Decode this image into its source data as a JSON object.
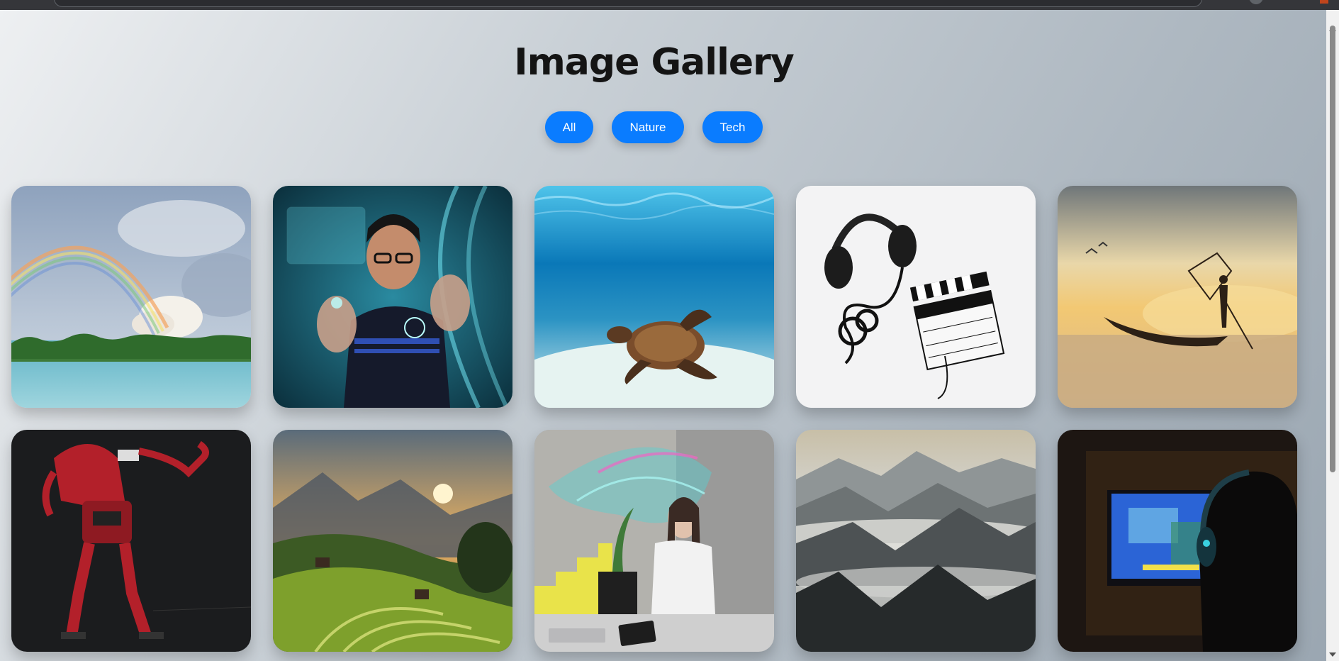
{
  "page": {
    "title": "Image Gallery"
  },
  "filters": [
    {
      "label": "All"
    },
    {
      "label": "Nature"
    },
    {
      "label": "Tech"
    }
  ],
  "colors": {
    "accent": "#0a7cff",
    "title": "#141414"
  },
  "gallery": [
    {
      "subject": "rainbow-over-lake-photo"
    },
    {
      "subject": "man-touching-holographic-interface-photo"
    },
    {
      "subject": "sea-turtle-underwater-photo"
    },
    {
      "subject": "headphones-and-film-clapperboard-photo"
    },
    {
      "subject": "fisherman-on-boat-at-sunset-photo"
    },
    {
      "subject": "red-humanoid-robot-photo"
    },
    {
      "subject": "rice-terraces-at-sunrise-photo"
    },
    {
      "subject": "woman-wearing-vr-headset-photo"
    },
    {
      "subject": "misty-mountain-valleys-photo"
    },
    {
      "subject": "person-gaming-in-front-of-tv-photo"
    }
  ]
}
